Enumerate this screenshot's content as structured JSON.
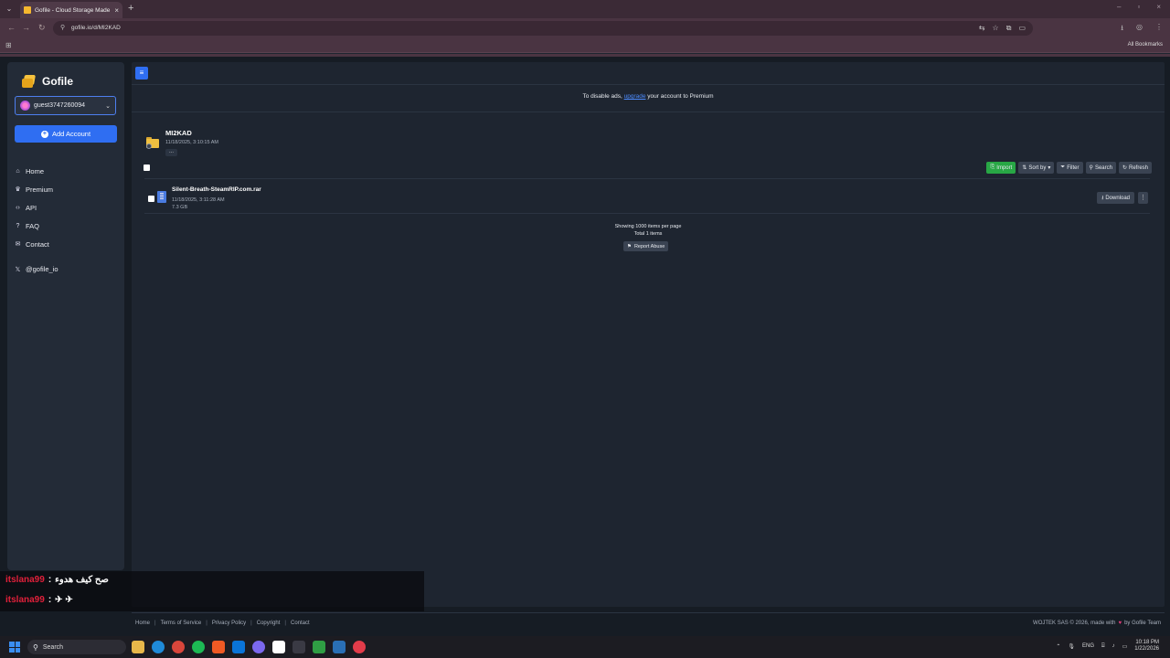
{
  "browser": {
    "tab_title": "Gofile - Cloud Storage Made Si",
    "url": "gofile.io/d/MI2KAD",
    "all_bookmarks": "All Bookmarks"
  },
  "sidebar": {
    "brand": "Gofile",
    "account": "guest3747260094",
    "add_account": "Add Account",
    "nav": [
      {
        "label": "Home",
        "icon": "home-icon"
      },
      {
        "label": "Premium",
        "icon": "crown-icon"
      },
      {
        "label": "API",
        "icon": "code-icon"
      },
      {
        "label": "FAQ",
        "icon": "question-icon"
      },
      {
        "label": "Contact",
        "icon": "envelope-icon"
      }
    ],
    "social": "@gofile_io"
  },
  "ad_notice": {
    "before": "To disable ads, ",
    "link": "upgrade",
    "after": " your account to Premium"
  },
  "folder": {
    "name": "MI2KAD",
    "date": "11/18/2025, 3:10:15 AM",
    "more": "..."
  },
  "actions": {
    "import": "Import",
    "sort": "Sort by",
    "filter": "Filter",
    "search": "Search",
    "refresh": "Refresh"
  },
  "files": [
    {
      "name": "Silent-Breath-SteamRIP.com.rar",
      "date": "11/18/2025, 3:11:28 AM",
      "size": "7.3 GB",
      "download": "Download"
    }
  ],
  "listing": {
    "showing": "Showing 1000 items per page",
    "total": "Total 1 items",
    "report": "Report Abuse"
  },
  "chat": [
    {
      "user": "itslana99",
      "sep": ":",
      "msg": "صح كيف هدوء"
    },
    {
      "user": "itslana99",
      "sep": ":",
      "msg": "✈ ✈"
    }
  ],
  "footer": {
    "links": [
      "Home",
      "Terms of Service",
      "Privacy Policy",
      "Copyright",
      "Contact"
    ],
    "credit_left": "WOJTEK SAS © 2026, made with",
    "credit_right": "by Gofile Team"
  },
  "taskbar": {
    "search": "Search",
    "lang": "ENG",
    "time": "10:18 PM",
    "date": "1/22/2026"
  },
  "colors": {
    "accent": "#2f6ef2",
    "import_green": "#28a745",
    "chat_user": "#e0203a"
  }
}
